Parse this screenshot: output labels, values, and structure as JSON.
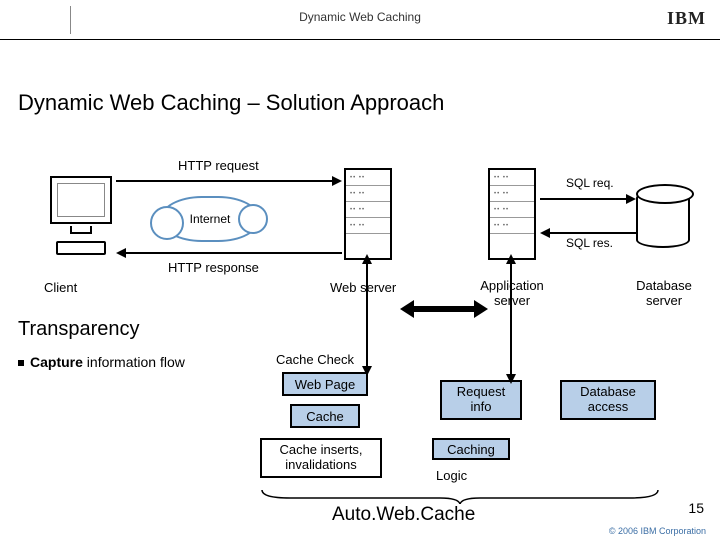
{
  "header": {
    "deck_title": "Dynamic Web Caching",
    "logo_text": "IBM"
  },
  "title": "Dynamic Web Caching – Solution Approach",
  "diagram": {
    "http_request": "HTTP request",
    "http_response": "HTTP response",
    "internet": "Internet",
    "sql_req": "SQL req.",
    "sql_res": "SQL res.",
    "client": "Client",
    "web_server": "Web server",
    "app_server": "Application server",
    "db_server": "Database server"
  },
  "section": {
    "heading": "Transparency",
    "bullet_prefix": "Capture",
    "bullet_rest": " information flow"
  },
  "boxes": {
    "cache_check": "Cache Check",
    "web_page": "Web Page",
    "cache": "Cache",
    "request_info_l1": "Request",
    "request_info_l2": "info",
    "db_access_l1": "Database",
    "db_access_l2": "access",
    "caching": "Caching",
    "inval_l1": "Cache inserts,",
    "inval_l2": "invalidations",
    "logic": "Logic"
  },
  "footer": {
    "brace_label": "Auto.Web.Cache",
    "slide_number": "15",
    "copyright": "© 2006 IBM Corporation"
  }
}
